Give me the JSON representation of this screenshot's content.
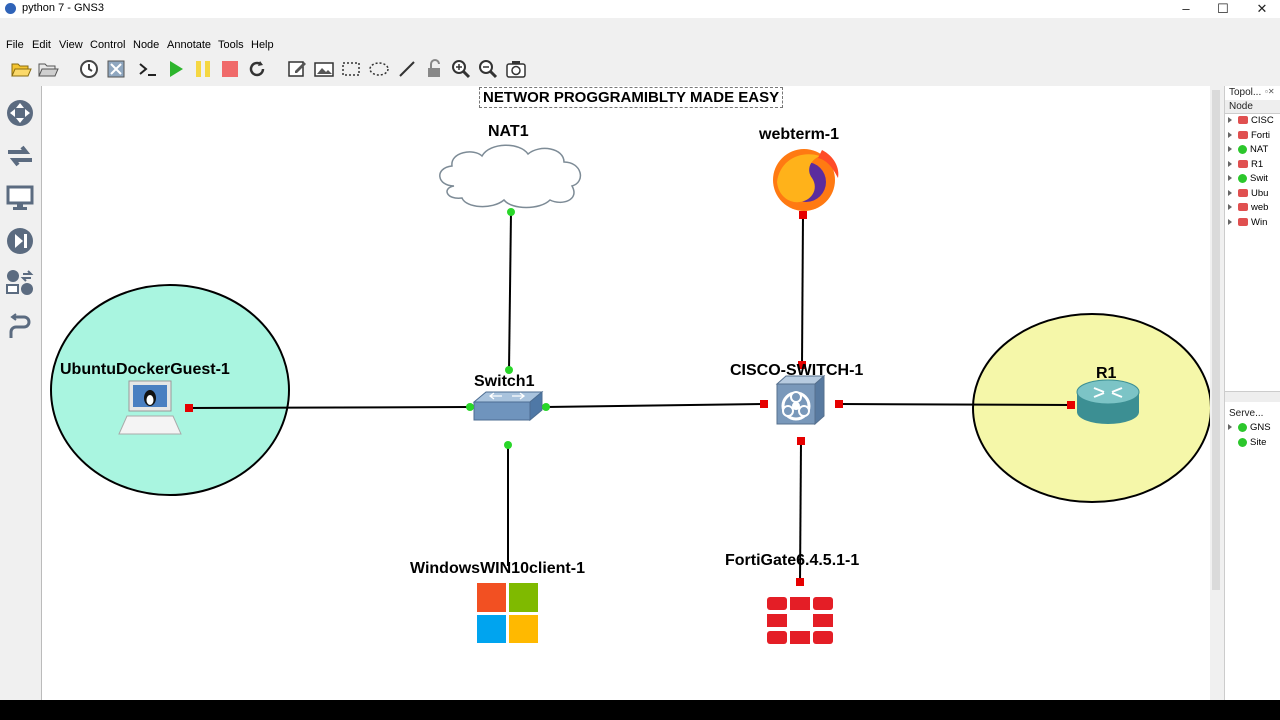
{
  "window": {
    "title": "python 7 - GNS3",
    "minimize": "‒",
    "maximize": "☐",
    "close": "✕"
  },
  "menu": [
    "File",
    "Edit",
    "View",
    "Control",
    "Node",
    "Annotate",
    "Tools",
    "Help"
  ],
  "canvas": {
    "note": "NETWOR PROGGRAMIBLTY MADE EASY"
  },
  "nodes": {
    "nat": "NAT1",
    "webterm": "webterm-1",
    "ubuntu": "UbuntuDockerGuest-1",
    "switch": "Switch1",
    "cisco": "CISCO-SWITCH-1",
    "r1": "R1",
    "windows": "WindowsWIN10client-1",
    "fortigate": "FortiGate6.4.5.1-1"
  },
  "topology_panel": {
    "title": "Topol...",
    "column": "Node",
    "items": [
      "CISC",
      "Forti",
      "NAT",
      "R1",
      "Swit",
      "Ubu",
      "web",
      "Win"
    ]
  },
  "servers_panel": {
    "title": "Serve...",
    "items": [
      "GNS",
      "Site"
    ]
  },
  "colors": {
    "ubuntu_fill": "#a9f5e0",
    "r1_fill": "#f5f7a9",
    "port_up": "#29d629",
    "port_down": "#e60000"
  }
}
